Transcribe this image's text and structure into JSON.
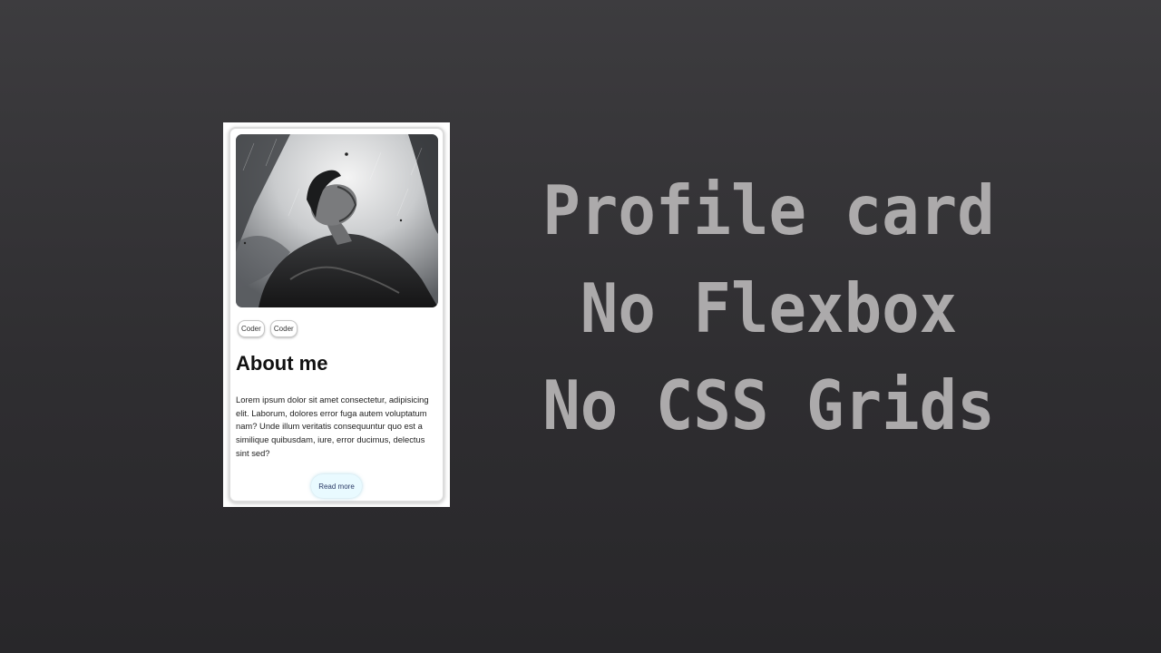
{
  "card": {
    "tags": [
      "Coder",
      "Coder"
    ],
    "title": "About me",
    "bio": "Lorem ipsum dolor sit amet consectetur, adipisicing elit. Laborum, dolores error fuga autem voluptatum nam? Unde illum veritatis consequuntur quo est a similique quibusdam, iure, error ducimus, delectus sint sed?",
    "button_label": "Read more"
  },
  "headline": {
    "line1": "Profile card",
    "line2": "No Flexbox",
    "line3": "No CSS Grids"
  },
  "colors": {
    "background": "#333235",
    "headline_text": "#acaaab",
    "button_bg": "#e9faff"
  }
}
